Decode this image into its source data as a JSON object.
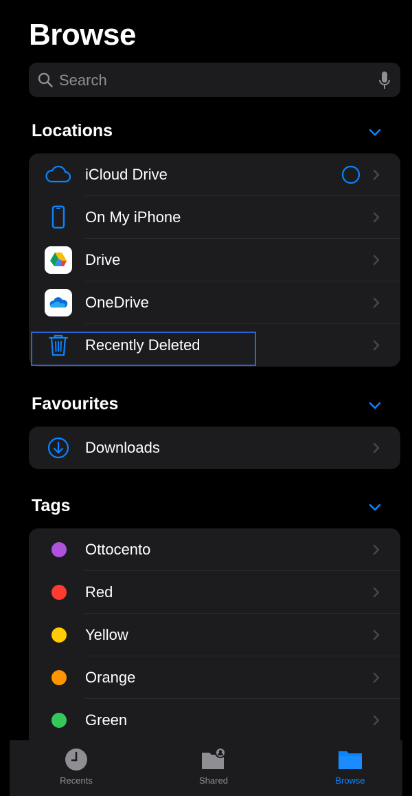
{
  "page": {
    "title": "Browse"
  },
  "search": {
    "placeholder": "Search"
  },
  "sections": {
    "locations": {
      "title": "Locations",
      "items": [
        {
          "label": "iCloud Drive",
          "icon": "icloud-icon"
        },
        {
          "label": "On My iPhone",
          "icon": "iphone-icon"
        },
        {
          "label": "Drive",
          "icon": "google-drive-icon"
        },
        {
          "label": "OneDrive",
          "icon": "onedrive-icon"
        },
        {
          "label": "Recently Deleted",
          "icon": "trash-icon"
        }
      ]
    },
    "favourites": {
      "title": "Favourites",
      "items": [
        {
          "label": "Downloads",
          "icon": "download-circle-icon"
        }
      ]
    },
    "tags": {
      "title": "Tags",
      "items": [
        {
          "label": "Ottocento",
          "color": "#af52de"
        },
        {
          "label": "Red",
          "color": "#ff3b30"
        },
        {
          "label": "Yellow",
          "color": "#ffcc00"
        },
        {
          "label": "Orange",
          "color": "#ff9500"
        },
        {
          "label": "Green",
          "color": "#34c759"
        }
      ]
    }
  },
  "tabbar": {
    "tabs": [
      {
        "label": "Recents",
        "icon": "clock-icon"
      },
      {
        "label": "Shared",
        "icon": "shared-folder-icon"
      },
      {
        "label": "Browse",
        "icon": "folder-icon",
        "active": true
      }
    ]
  },
  "colors": {
    "accent": "#0a84ff",
    "highlight": "#2a64d6"
  }
}
